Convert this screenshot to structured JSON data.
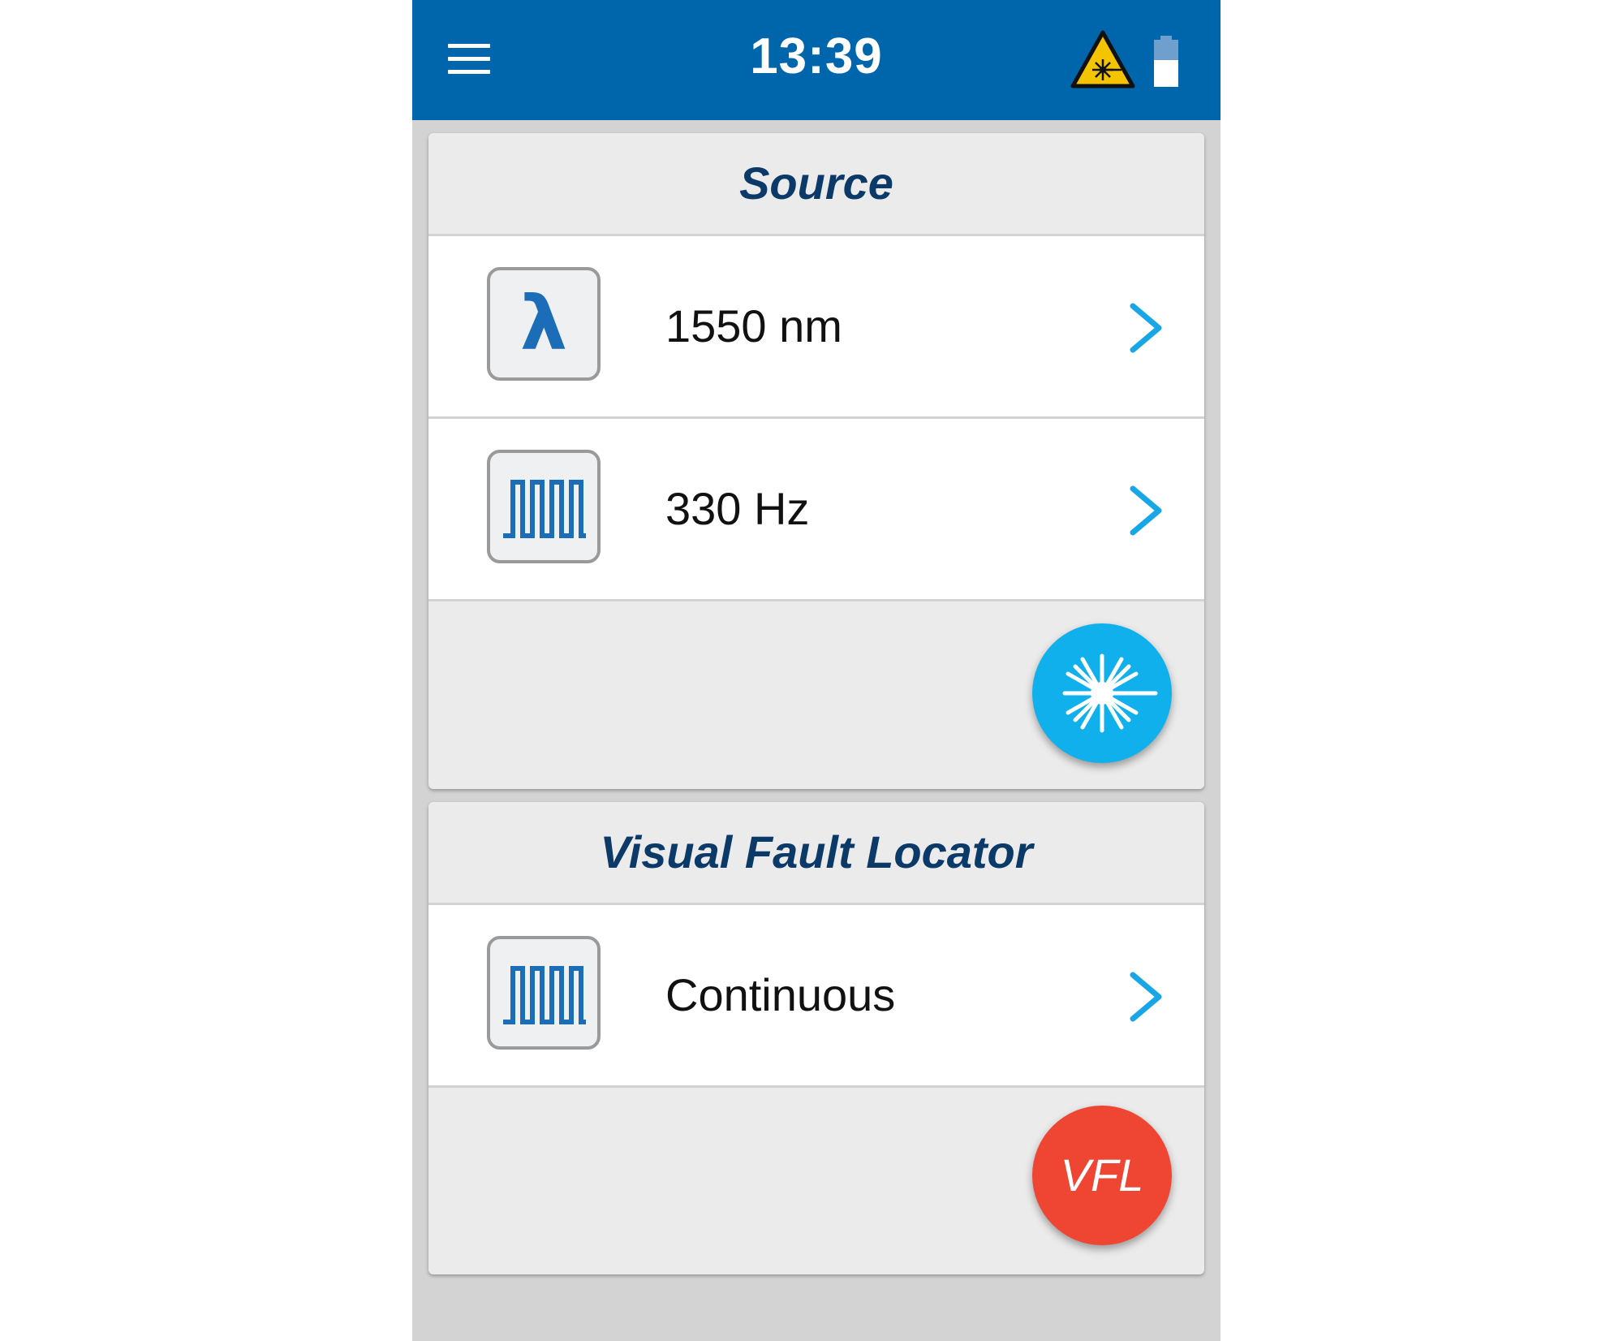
{
  "status_bar": {
    "time": "13:39",
    "menu_icon": "hamburger-menu-icon",
    "warning_icon": "laser-warning-icon",
    "battery_icon": "battery-icon"
  },
  "source": {
    "title": "Source",
    "rows": [
      {
        "icon": "wavelength-lambda-icon",
        "icon_text": "λ",
        "label": "1550 nm"
      },
      {
        "icon": "pulse-modulation-icon",
        "label": "330 Hz"
      }
    ],
    "action_icon": "laser-emit-icon"
  },
  "vfl": {
    "title": "Visual Fault Locator",
    "rows": [
      {
        "icon": "pulse-modulation-icon",
        "label": "Continuous"
      }
    ],
    "action_label": "VFL"
  },
  "colors": {
    "header": "#0066ac",
    "title_text": "#0b3a68",
    "accent": "#10b0ec",
    "vfl_button": "#ef4634",
    "icon_blue": "#1a6db6",
    "warning_yellow": "#f5c400"
  }
}
